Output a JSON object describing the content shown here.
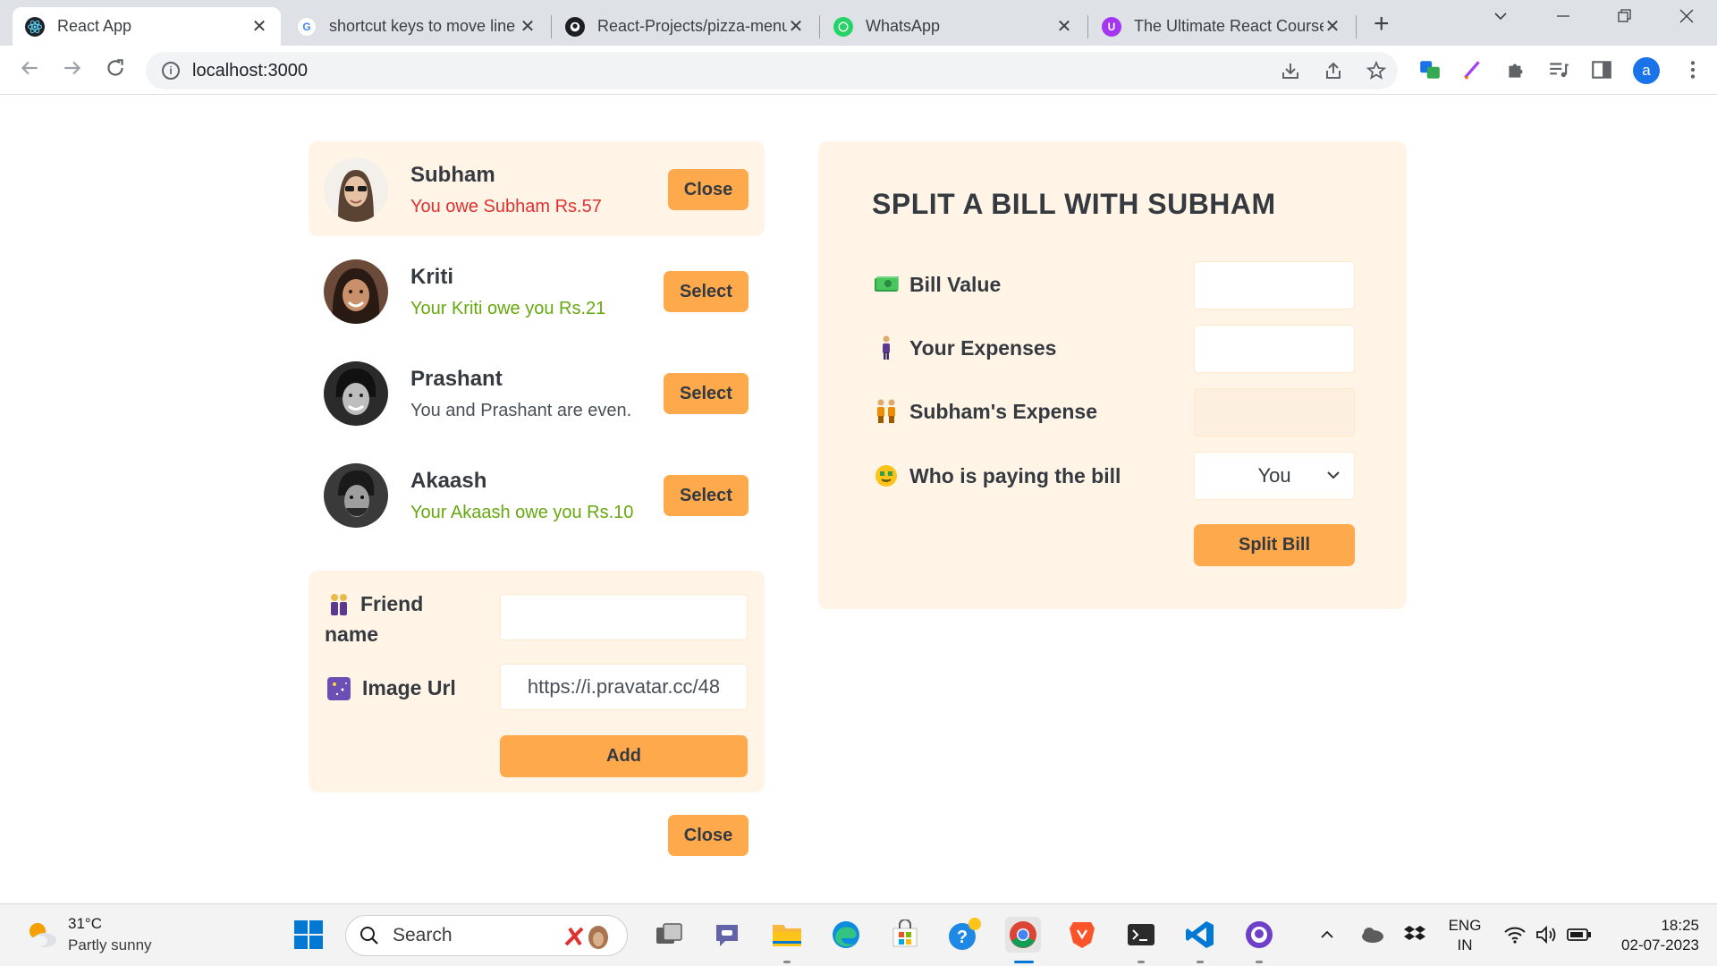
{
  "browser": {
    "tabs": [
      {
        "title": "React App",
        "icon": "react-icon",
        "active": true
      },
      {
        "title": "shortcut keys to move line",
        "icon": "google-icon",
        "active": false
      },
      {
        "title": "React-Projects/pizza-menu",
        "icon": "github-icon",
        "active": false
      },
      {
        "title": "WhatsApp",
        "icon": "whatsapp-icon",
        "active": false
      },
      {
        "title": "The Ultimate React Course",
        "icon": "udemy-icon",
        "active": false
      }
    ],
    "url": "localhost:3000"
  },
  "friends": [
    {
      "name": "Subham",
      "status": "You owe Subham Rs.57",
      "status_type": "owe",
      "button": "Close",
      "selected": true
    },
    {
      "name": "Kriti",
      "status": "Your Kriti owe you Rs.21",
      "status_type": "owed",
      "button": "Select",
      "selected": false
    },
    {
      "name": "Prashant",
      "status": "You and Prashant are even.",
      "status_type": "even",
      "button": "Select",
      "selected": false
    },
    {
      "name": "Akaash",
      "status": "Your Akaash owe you Rs.10",
      "status_type": "owed",
      "button": "Select",
      "selected": false
    }
  ],
  "add_friend_form": {
    "friend_name_label": "Friend name",
    "friend_name_value": "",
    "image_url_label": "Image Url",
    "image_url_value": "https://i.pravatar.cc/48",
    "add_button": "Add"
  },
  "close_button": "Close",
  "split_form": {
    "title": "SPLIT A BILL WITH SUBHAM",
    "bill_value_label": "Bill Value",
    "your_expense_label": "Your Expenses",
    "friend_expense_label": "Subham's Expense",
    "payer_label": "Who is paying the bill",
    "payer_value": "You",
    "submit_button": "Split Bill"
  },
  "taskbar": {
    "temperature": "31°C",
    "weather": "Partly sunny",
    "search_placeholder": "Search",
    "lang_top": "ENG",
    "lang_bottom": "IN",
    "time": "18:25",
    "date": "02-07-2023"
  },
  "colors": {
    "accent": "#ffa94d",
    "panel": "#fff4e6",
    "red": "#e03131",
    "green": "#66a80f"
  }
}
